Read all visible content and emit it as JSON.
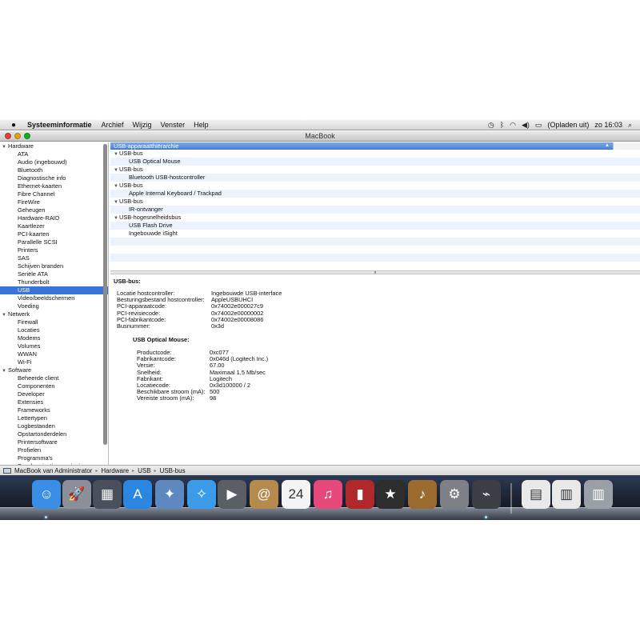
{
  "menubar": {
    "app_name": "Systeeminformatie",
    "menus": [
      "Archief",
      "Wijzig",
      "Venster",
      "Help"
    ],
    "battery_status": "(Opladen uit)",
    "clock": "zo 16:03"
  },
  "window": {
    "title": "MacBook"
  },
  "sidebar": {
    "categories": [
      {
        "label": "Hardware",
        "items": [
          "ATA",
          "Audio (ingebouwd)",
          "Bluetooth",
          "Diagnostische info",
          "Ethernet-kaarten",
          "Fibre Channel",
          "FireWire",
          "Geheugen",
          "Hardware-RAID",
          "Kaartlezer",
          "PCI-kaarten",
          "Parallelle SCSI",
          "Printers",
          "SAS",
          "Schijven branden",
          "Seriële ATA",
          "Thunderbolt",
          "USB",
          "Video/beeldschermen",
          "Voeding"
        ]
      },
      {
        "label": "Netwerk",
        "items": [
          "Firewall",
          "Locaties",
          "Modems",
          "Volumes",
          "WWAN",
          "Wi-Fi"
        ]
      },
      {
        "label": "Software",
        "items": [
          "Beheerde client",
          "Componenten",
          "Developer",
          "Extensies",
          "Frameworks",
          "Lettertypen",
          "Logbestanden",
          "Opstartonderdelen",
          "Printersoftware",
          "Profielen",
          "Programma's",
          "Synchronisatievoorzieningen"
        ]
      }
    ],
    "selected": "USB"
  },
  "tree": {
    "header": "USB-apparaatthiërarchie",
    "rows": [
      {
        "type": "bus",
        "label": "USB-bus"
      },
      {
        "type": "device",
        "label": "USB Optical Mouse"
      },
      {
        "type": "bus",
        "label": "USB-bus"
      },
      {
        "type": "device",
        "label": "Bluetooth USB-hostcontroller"
      },
      {
        "type": "bus",
        "label": "USB-bus"
      },
      {
        "type": "device",
        "label": "Apple Internal Keyboard / Trackpad"
      },
      {
        "type": "bus",
        "label": "USB-bus"
      },
      {
        "type": "device",
        "label": "IR-ontvanger"
      },
      {
        "type": "bus",
        "label": "USB-hogesnelheidsbus"
      },
      {
        "type": "device",
        "label": "USB Flash Drive"
      },
      {
        "type": "device",
        "label": "Ingebouwde iSight"
      }
    ]
  },
  "detail": {
    "heading": "USB-bus:",
    "bus_info": [
      {
        "key": "Locatie hostcontroller:",
        "value": "Ingebouwde USB-interface"
      },
      {
        "key": "Besturingsbestand hostcontroller:",
        "value": "AppleUSBUHCI"
      },
      {
        "key": "PCI-apparaatcode:",
        "value": "0x74002e000027c9"
      },
      {
        "key": "PCI-revisiecode:",
        "value": "0x74002e00000002"
      },
      {
        "key": "PCI-fabrikantcode:",
        "value": "0x74002e00008086"
      },
      {
        "key": "Busnummer:",
        "value": "0x3d"
      }
    ],
    "device_heading": "USB Optical Mouse:",
    "device_info": [
      {
        "key": "Productcode:",
        "value": "0xc077"
      },
      {
        "key": "Fabrikantcode:",
        "value": "0x046d  (Logitech Inc.)"
      },
      {
        "key": "Versie:",
        "value": "67.00"
      },
      {
        "key": "Snelheid:",
        "value": "Maximaal 1,5 Mb/sec"
      },
      {
        "key": "Fabrikant:",
        "value": "Logitech"
      },
      {
        "key": "Locatiecode:",
        "value": "0x3d100000 / 2"
      },
      {
        "key": "Beschikbare stroom (mA):",
        "value": "500"
      },
      {
        "key": "Vereiste stroom (mA):",
        "value": "98"
      }
    ]
  },
  "pathbar": {
    "items": [
      "MacBook van Administrator",
      "Hardware",
      "USB",
      "USB-bus"
    ]
  },
  "dock": {
    "icons": [
      {
        "name": "finder-icon",
        "glyph": "☺",
        "color": "#3a8ee6"
      },
      {
        "name": "launchpad-icon",
        "glyph": "🚀",
        "color": "#8a8f99"
      },
      {
        "name": "mission-control-icon",
        "glyph": "▦",
        "color": "#4a4f5c"
      },
      {
        "name": "app-store-icon",
        "glyph": "A",
        "color": "#2a86e0"
      },
      {
        "name": "preview-icon",
        "glyph": "✦",
        "color": "#5e88c0"
      },
      {
        "name": "safari-icon",
        "glyph": "✧",
        "color": "#3b9be8"
      },
      {
        "name": "facetime-icon",
        "glyph": "▶",
        "color": "#5a5f66"
      },
      {
        "name": "address-book-icon",
        "glyph": "@",
        "color": "#b58a4c"
      },
      {
        "name": "calendar-icon",
        "glyph": "24",
        "color": "#f4f4f4"
      },
      {
        "name": "itunes-icon",
        "glyph": "♫",
        "color": "#e7487a"
      },
      {
        "name": "photo-booth-icon",
        "glyph": "▮",
        "color": "#b0282a"
      },
      {
        "name": "imovie-icon",
        "glyph": "★",
        "color": "#2d2d2d"
      },
      {
        "name": "garageband-icon",
        "glyph": "♪",
        "color": "#9a6a2e"
      },
      {
        "name": "system-preferences-icon",
        "glyph": "⚙",
        "color": "#7d8087"
      },
      {
        "name": "system-information-icon",
        "glyph": "⌁",
        "color": "#3b3e44"
      },
      {
        "name": "document-icon",
        "glyph": "▤",
        "color": "#e9e9e9"
      },
      {
        "name": "text-document-icon",
        "glyph": "▥",
        "color": "#e9e9e9"
      },
      {
        "name": "trash-icon",
        "glyph": "▥",
        "color": "#9aa0a8"
      }
    ]
  }
}
